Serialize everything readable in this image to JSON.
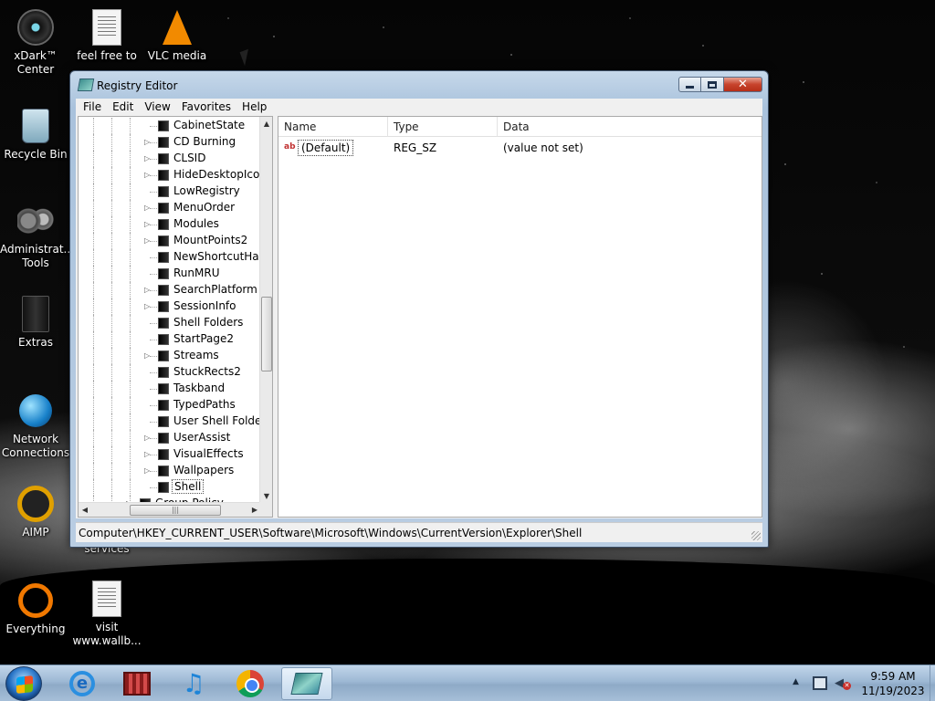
{
  "desktop": {
    "icons": [
      {
        "label": "xDark™ Center",
        "icon": "xdark-center-icon"
      },
      {
        "label": "feel free to",
        "icon": "text-document-icon"
      },
      {
        "label": "VLC media",
        "icon": "vlc-cone-icon"
      },
      {
        "label": "Recycle Bin",
        "icon": "recycle-bin-icon"
      },
      {
        "label": "Administrat... Tools",
        "icon": "admin-tools-gears-icon"
      },
      {
        "label": "Extras",
        "icon": "extras-folder-icon"
      },
      {
        "label": "Network Connections",
        "icon": "network-globe-icon"
      },
      {
        "label": "AIMP",
        "icon": "aimp-ring-icon"
      },
      {
        "label": "Everything",
        "icon": "everything-ring-icon"
      },
      {
        "label": "visit www.wallb...",
        "icon": "text-document-icon"
      },
      {
        "label": "services",
        "icon": "none"
      }
    ]
  },
  "window": {
    "title": "Registry Editor",
    "menu": [
      "File",
      "Edit",
      "View",
      "Favorites",
      "Help"
    ],
    "tree": {
      "items": [
        {
          "label": "CabinetState",
          "expandable": false
        },
        {
          "label": "CD Burning",
          "expandable": true
        },
        {
          "label": "CLSID",
          "expandable": true
        },
        {
          "label": "HideDesktopIcon",
          "expandable": true
        },
        {
          "label": "LowRegistry",
          "expandable": false
        },
        {
          "label": "MenuOrder",
          "expandable": true
        },
        {
          "label": "Modules",
          "expandable": true
        },
        {
          "label": "MountPoints2",
          "expandable": true
        },
        {
          "label": "NewShortcutHan",
          "expandable": false
        },
        {
          "label": "RunMRU",
          "expandable": false
        },
        {
          "label": "SearchPlatform",
          "expandable": true
        },
        {
          "label": "SessionInfo",
          "expandable": true
        },
        {
          "label": "Shell Folders",
          "expandable": false
        },
        {
          "label": "StartPage2",
          "expandable": false
        },
        {
          "label": "Streams",
          "expandable": true
        },
        {
          "label": "StuckRects2",
          "expandable": false
        },
        {
          "label": "Taskband",
          "expandable": false
        },
        {
          "label": "TypedPaths",
          "expandable": false
        },
        {
          "label": "User Shell Folders",
          "expandable": false
        },
        {
          "label": "UserAssist",
          "expandable": true
        },
        {
          "label": "VisualEffects",
          "expandable": true
        },
        {
          "label": "Wallpapers",
          "expandable": true
        },
        {
          "label": "Shell",
          "expandable": false,
          "selected": true
        },
        {
          "label": "Group Policy",
          "expandable": true,
          "parent_level": true
        }
      ]
    },
    "list": {
      "columns": [
        "Name",
        "Type",
        "Data"
      ],
      "rows": [
        {
          "name": "(Default)",
          "type": "REG_SZ",
          "data": "(value not set)",
          "icon": "string-value-ab-icon"
        }
      ]
    },
    "status_path": "Computer\\HKEY_CURRENT_USER\\Software\\Microsoft\\Windows\\CurrentVersion\\Explorer\\Shell"
  },
  "taskbar": {
    "pinned": [
      {
        "name": "internet-explorer",
        "icon": "internet-explorer-icon"
      },
      {
        "name": "media-center",
        "icon": "film-icon"
      },
      {
        "name": "music-player",
        "icon": "music-note-icon"
      },
      {
        "name": "chrome",
        "icon": "chrome-icon"
      },
      {
        "name": "registry-editor",
        "icon": "registry-editor-icon",
        "active": true
      }
    ],
    "clock": {
      "time": "9:59 AM",
      "date": "11/19/2023"
    }
  }
}
